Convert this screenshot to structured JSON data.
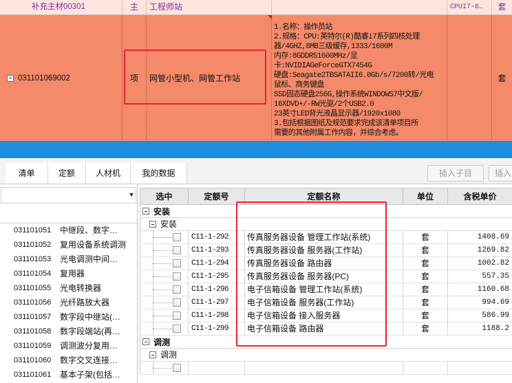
{
  "top_grid": {
    "rows": [
      {
        "code": "补充主材00301",
        "type": "主",
        "name": "工程师站",
        "spec": "CPUI7-6…",
        "unit": "套"
      },
      {
        "code": "031101069002",
        "type": "项",
        "name": "网管小型机、网管工作站",
        "description": [
          "1.名称：操作员站",
          "2.规格：CPU:英特尔(R)酷睿i7系列四核处理",
          "器/4GHZ,8MB三级缓存,1333/1600M",
          "内存:8GDDR51600MHz/显",
          "卡:NVIDIAGeForceGTX7454G",
          "硬盘:Seagate2TBSATAII6.0Gb/s/7200转/光电",
          "鼠标、商务键盘",
          "SSD固态硬盘256G,操作系统WINDOWS7中文版/",
          "16XDVD+/-RW光驱/2个USB2.0",
          "23英寸LED背光液晶显示器/1920x1080",
          "3.包括根据图纸及规范要求完成该清单项目所",
          "需要的其他附属工作内容，并综合考虑。"
        ],
        "unit": "套"
      }
    ]
  },
  "tabs": [
    {
      "label": "清单"
    },
    {
      "label": "定额"
    },
    {
      "label": "人材机"
    },
    {
      "label": "我的数据"
    }
  ],
  "toolbar": {
    "insert_sub_item": "插入子目",
    "insert": "插入"
  },
  "left_panel": {
    "items": [
      {
        "code": "031101051",
        "name": "中继段、数字…"
      },
      {
        "code": "031101052",
        "name": "复用设备系统调测"
      },
      {
        "code": "031101053",
        "name": "光电调测中间…"
      },
      {
        "code": "031101054",
        "name": "复用器"
      },
      {
        "code": "031101055",
        "name": "光电转换器"
      },
      {
        "code": "031101056",
        "name": "光纤路放大器"
      },
      {
        "code": "031101057",
        "name": "数字段中继站(…"
      },
      {
        "code": "031101058",
        "name": "数字段端站(再…"
      },
      {
        "code": "031101059",
        "name": "调测波分复用…"
      },
      {
        "code": "031101060",
        "name": "数字交叉连接…"
      },
      {
        "code": "031101061",
        "name": "基本子架(包括…"
      }
    ]
  },
  "quota_table": {
    "headers": {
      "select": "选中",
      "code": "定额号",
      "name": "定额名称",
      "unit": "单位",
      "price": "含税单价"
    },
    "groups": [
      {
        "label": "安装",
        "subgroups": [
          {
            "label": "安装",
            "items": [
              {
                "checked": false,
                "code": "C11-1-292",
                "name": "传真服务器设备 管理工作站(系统)",
                "unit": "套",
                "price": "1408.69"
              },
              {
                "checked": false,
                "code": "C11-1-293",
                "name": "传真服务器设备 服务器(工作站)",
                "unit": "套",
                "price": "1269.82"
              },
              {
                "checked": false,
                "code": "C11-1-294",
                "name": "传真服务器设备 路由器",
                "unit": "套",
                "price": "1002.82"
              },
              {
                "checked": false,
                "code": "C11-1-295",
                "name": "传真服务器设备 服务器(PC)",
                "unit": "套",
                "price": "557.35"
              },
              {
                "checked": false,
                "code": "C11-1-296",
                "name": "电子信箱设备 管理工作站(系统)",
                "unit": "套",
                "price": "1160.68"
              },
              {
                "checked": false,
                "code": "C11-1-297",
                "name": "电子信箱设备 服务器(工作站)",
                "unit": "套",
                "price": "994.69"
              },
              {
                "checked": false,
                "code": "C11-1-298",
                "name": "电子信箱设备 接入服务器",
                "unit": "套",
                "price": "586.99"
              },
              {
                "checked": false,
                "code": "C11-1-299",
                "name": "电子信箱设备 路由器",
                "unit": "套",
                "price": "1188.2"
              }
            ]
          }
        ]
      },
      {
        "label": "调测",
        "subgroups": [
          {
            "label": "调测",
            "items": [
              {
                "checked": false
              }
            ]
          }
        ]
      }
    ]
  },
  "colors": {
    "row_highlight": "#F48A69",
    "row_material": "#FCE5DE",
    "band": "#1B8EE0",
    "annotation": "#E8242B",
    "material_text": "#7E2FA5"
  },
  "icons": {
    "collapse": "minus-box-icon",
    "dropdown": "chevron-down-icon",
    "checkbox": "checkbox-icon"
  }
}
